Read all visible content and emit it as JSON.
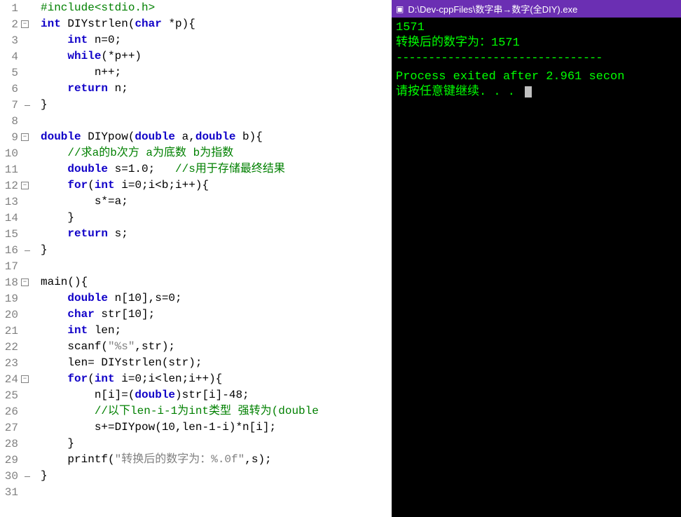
{
  "lines": [
    {
      "n": "1",
      "fold": {
        "line": ""
      },
      "seg": [
        {
          "c": "pre",
          "t": "#include<stdio.h>"
        }
      ]
    },
    {
      "n": "2",
      "fold": {
        "box": "−",
        "line": "bot"
      },
      "seg": [
        {
          "c": "kw",
          "t": "int"
        },
        {
          "c": "pln",
          "t": " DIYstrlen("
        },
        {
          "c": "kw",
          "t": "char"
        },
        {
          "c": "pln",
          "t": " *p){"
        }
      ]
    },
    {
      "n": "3",
      "fold": {
        "line": "full"
      },
      "ind": 1,
      "seg": [
        {
          "c": "pln",
          "t": "    "
        },
        {
          "c": "kw",
          "t": "int"
        },
        {
          "c": "pln",
          "t": " n=0;"
        }
      ]
    },
    {
      "n": "4",
      "fold": {
        "line": "full"
      },
      "ind": 1,
      "seg": [
        {
          "c": "pln",
          "t": "    "
        },
        {
          "c": "kw",
          "t": "while"
        },
        {
          "c": "pln",
          "t": "(*p++)"
        }
      ]
    },
    {
      "n": "5",
      "fold": {
        "line": "full"
      },
      "ind": 1,
      "seg": [
        {
          "c": "pln",
          "t": "        n++;"
        }
      ]
    },
    {
      "n": "6",
      "fold": {
        "line": "full"
      },
      "ind": 1,
      "seg": [
        {
          "c": "pln",
          "t": "    "
        },
        {
          "c": "kw",
          "t": "return"
        },
        {
          "c": "pln",
          "t": " n;"
        }
      ]
    },
    {
      "n": "7",
      "fold": {
        "line": "top",
        "corner": true
      },
      "seg": [
        {
          "c": "pln",
          "t": "}"
        }
      ]
    },
    {
      "n": "8",
      "fold": {},
      "seg": [
        {
          "c": "pln",
          "t": ""
        }
      ]
    },
    {
      "n": "9",
      "fold": {
        "box": "−",
        "line": "bot"
      },
      "seg": [
        {
          "c": "kw",
          "t": "double"
        },
        {
          "c": "pln",
          "t": " DIYpow("
        },
        {
          "c": "kw",
          "t": "double"
        },
        {
          "c": "pln",
          "t": " a,"
        },
        {
          "c": "kw",
          "t": "double"
        },
        {
          "c": "pln",
          "t": " b){"
        }
      ]
    },
    {
      "n": "10",
      "fold": {
        "line": "full"
      },
      "ind": 1,
      "seg": [
        {
          "c": "pln",
          "t": "    "
        },
        {
          "c": "cmt",
          "t": "//求a的b次方 a为底数 b为指数 "
        }
      ]
    },
    {
      "n": "11",
      "fold": {
        "line": "full"
      },
      "ind": 1,
      "seg": [
        {
          "c": "pln",
          "t": "    "
        },
        {
          "c": "kw",
          "t": "double"
        },
        {
          "c": "pln",
          "t": " s=1.0;   "
        },
        {
          "c": "cmt",
          "t": "//s用于存储最终结果 "
        }
      ]
    },
    {
      "n": "12",
      "fold": {
        "box": "−",
        "line": "full"
      },
      "ind": 1,
      "seg": [
        {
          "c": "pln",
          "t": "    "
        },
        {
          "c": "kw",
          "t": "for"
        },
        {
          "c": "pln",
          "t": "("
        },
        {
          "c": "kw",
          "t": "int"
        },
        {
          "c": "pln",
          "t": " i=0;i<b;i++){"
        }
      ]
    },
    {
      "n": "13",
      "fold": {
        "line": "full"
      },
      "ind": 1,
      "seg": [
        {
          "c": "pln",
          "t": "        s*=a;"
        }
      ]
    },
    {
      "n": "14",
      "fold": {
        "line": "full"
      },
      "ind": 1,
      "seg": [
        {
          "c": "pln",
          "t": "    }"
        }
      ]
    },
    {
      "n": "15",
      "fold": {
        "line": "full"
      },
      "ind": 1,
      "seg": [
        {
          "c": "pln",
          "t": "    "
        },
        {
          "c": "kw",
          "t": "return"
        },
        {
          "c": "pln",
          "t": " s;"
        }
      ]
    },
    {
      "n": "16",
      "fold": {
        "line": "top",
        "corner": true
      },
      "seg": [
        {
          "c": "pln",
          "t": "}"
        }
      ]
    },
    {
      "n": "17",
      "fold": {},
      "seg": [
        {
          "c": "pln",
          "t": ""
        }
      ]
    },
    {
      "n": "18",
      "fold": {
        "box": "−",
        "line": "bot"
      },
      "seg": [
        {
          "c": "pln",
          "t": "main(){"
        }
      ]
    },
    {
      "n": "19",
      "fold": {
        "line": "full"
      },
      "ind": 1,
      "seg": [
        {
          "c": "pln",
          "t": "    "
        },
        {
          "c": "kw",
          "t": "double"
        },
        {
          "c": "pln",
          "t": " n[10],s=0;"
        }
      ]
    },
    {
      "n": "20",
      "fold": {
        "line": "full"
      },
      "ind": 1,
      "seg": [
        {
          "c": "pln",
          "t": "    "
        },
        {
          "c": "kw",
          "t": "char"
        },
        {
          "c": "pln",
          "t": " str[10];"
        }
      ]
    },
    {
      "n": "21",
      "fold": {
        "line": "full"
      },
      "ind": 1,
      "seg": [
        {
          "c": "pln",
          "t": "    "
        },
        {
          "c": "kw",
          "t": "int"
        },
        {
          "c": "pln",
          "t": " len;"
        }
      ]
    },
    {
      "n": "22",
      "fold": {
        "line": "full"
      },
      "ind": 1,
      "seg": [
        {
          "c": "pln",
          "t": "    scanf("
        },
        {
          "c": "str",
          "t": "\"%s\""
        },
        {
          "c": "pln",
          "t": ",str);"
        }
      ]
    },
    {
      "n": "23",
      "fold": {
        "line": "full"
      },
      "ind": 1,
      "seg": [
        {
          "c": "pln",
          "t": "    len= DIYstrlen(str);"
        }
      ]
    },
    {
      "n": "24",
      "fold": {
        "box": "−",
        "line": "full"
      },
      "ind": 1,
      "seg": [
        {
          "c": "pln",
          "t": "    "
        },
        {
          "c": "kw",
          "t": "for"
        },
        {
          "c": "pln",
          "t": "("
        },
        {
          "c": "kw",
          "t": "int"
        },
        {
          "c": "pln",
          "t": " i=0;i<len;i++){"
        }
      ]
    },
    {
      "n": "25",
      "fold": {
        "line": "full"
      },
      "ind": 2,
      "seg": [
        {
          "c": "pln",
          "t": "        n[i]=("
        },
        {
          "c": "kw",
          "t": "double"
        },
        {
          "c": "pln",
          "t": ")str[i]-48;"
        }
      ]
    },
    {
      "n": "26",
      "fold": {
        "line": "full"
      },
      "ind": 2,
      "seg": [
        {
          "c": "pln",
          "t": "        "
        },
        {
          "c": "cmt",
          "t": "//以下len-i-1为int类型 强转为(double"
        }
      ]
    },
    {
      "n": "27",
      "fold": {
        "line": "full"
      },
      "ind": 2,
      "seg": [
        {
          "c": "pln",
          "t": "        s+=DIYpow(10,len-1-i)*n[i];"
        }
      ]
    },
    {
      "n": "28",
      "fold": {
        "line": "full"
      },
      "ind": 1,
      "seg": [
        {
          "c": "pln",
          "t": "    }"
        }
      ]
    },
    {
      "n": "29",
      "fold": {
        "line": "full"
      },
      "ind": 1,
      "seg": [
        {
          "c": "pln",
          "t": "    printf("
        },
        {
          "c": "str",
          "t": "\"转换后的数字为：%.0f\""
        },
        {
          "c": "pln",
          "t": ",s);"
        }
      ]
    },
    {
      "n": "30",
      "fold": {
        "line": "top",
        "corner": true
      },
      "seg": [
        {
          "c": "pln",
          "t": "}"
        }
      ]
    },
    {
      "n": "31",
      "fold": {},
      "seg": [
        {
          "c": "pln",
          "t": ""
        }
      ]
    }
  ],
  "terminal": {
    "title": "D:\\Dev-cppFiles\\数字串→数字(全DIY).exe",
    "out1": "1571",
    "out2": "转换后的数字为：1571",
    "hr": "--------------------------------",
    "out3": "Process exited after 2.961 secon",
    "out4": "请按任意键继续. . . "
  }
}
